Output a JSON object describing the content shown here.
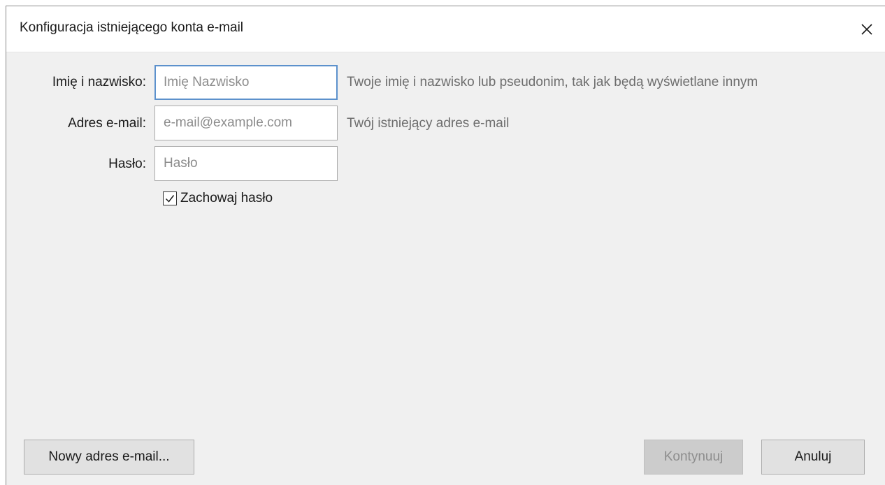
{
  "dialog": {
    "title": "Konfiguracja istniejącego konta e-mail"
  },
  "form": {
    "name_label": "Imię i nazwisko:",
    "name_placeholder": "Imię Nazwisko",
    "name_hint": "Twoje imię i nazwisko lub pseudonim, tak jak będą wyświetlane innym",
    "email_label": "Adres e-mail:",
    "email_placeholder": "e-mail@example.com",
    "email_hint": "Twój istniejący adres e-mail",
    "password_label": "Hasło:",
    "password_placeholder": "Hasło",
    "remember_label": "Zachowaj hasło",
    "remember_checked": true
  },
  "buttons": {
    "new_address": "Nowy adres e-mail...",
    "continue": "Kontynuuj",
    "cancel": "Anuluj"
  },
  "icons": {
    "close": "close-icon",
    "check": "checkmark-icon"
  }
}
